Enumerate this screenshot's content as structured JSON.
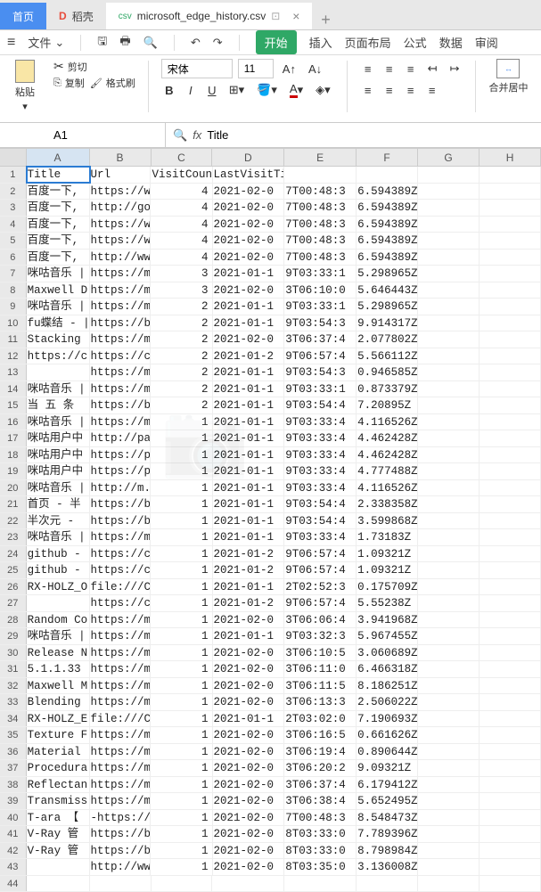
{
  "tabs": {
    "home": "首页",
    "shell": "稻壳",
    "file": "microsoft_edge_history.csv"
  },
  "menus": {
    "file": "文件",
    "start": "开始",
    "insert": "插入",
    "layout": "页面布局",
    "formula": "公式",
    "data": "数据",
    "review": "审阅"
  },
  "ribbon": {
    "paste": "粘贴",
    "cut": "剪切",
    "copy": "复制",
    "format_painter": "格式刷",
    "fontname": "宋体",
    "fontsize": "11",
    "merge": "合并居中"
  },
  "namebox": "A1",
  "formula_value": "Title",
  "columns": [
    "A",
    "B",
    "C",
    "D",
    "E",
    "F",
    "G",
    "H"
  ],
  "rows": [
    {
      "n": 1,
      "A": "Title",
      "B": "Url",
      "C": "VisitCount",
      "D": "LastVisitTime",
      "E": "",
      "F": ""
    },
    {
      "n": 2,
      "A": "百度一下,",
      "B": "https://w",
      "C": "4",
      "D": "2021-02-0",
      "E": "7T00:48:3",
      "F": "6.594389Z"
    },
    {
      "n": 3,
      "A": "百度一下,",
      "B": "http://go",
      "C": "4",
      "D": "2021-02-0",
      "E": "7T00:48:3",
      "F": "6.594389Z"
    },
    {
      "n": 4,
      "A": "百度一下,",
      "B": "https://w",
      "C": "4",
      "D": "2021-02-0",
      "E": "7T00:48:3",
      "F": "6.594389Z"
    },
    {
      "n": 5,
      "A": "百度一下,",
      "B": "https://w",
      "C": "4",
      "D": "2021-02-0",
      "E": "7T00:48:3",
      "F": "6.594389Z"
    },
    {
      "n": 6,
      "A": "百度一下,",
      "B": "http://ww",
      "C": "4",
      "D": "2021-02-0",
      "E": "7T00:48:3",
      "F": "6.594389Z"
    },
    {
      "n": 7,
      "A": "咪咕音乐 |",
      "B": "https://m",
      "C": "3",
      "D": "2021-01-1",
      "E": "9T03:33:1",
      "F": "5.298965Z"
    },
    {
      "n": 8,
      "A": "Maxwell D",
      "B": "https://m",
      "C": "3",
      "D": "2021-02-0",
      "E": "3T06:10:0",
      "F": "5.646443Z"
    },
    {
      "n": 9,
      "A": "咪咕音乐 |",
      "B": "https://m",
      "C": "2",
      "D": "2021-01-1",
      "E": "9T03:33:1",
      "F": "5.298965Z"
    },
    {
      "n": 10,
      "A": "fu蝶结 - |",
      "B": "https://b",
      "C": "2",
      "D": "2021-01-1",
      "E": "9T03:54:3",
      "F": "9.914317Z"
    },
    {
      "n": 11,
      "A": "Stacking ",
      "B": "https://m",
      "C": "2",
      "D": "2021-02-0",
      "E": "3T06:37:4",
      "F": "2.077802Z"
    },
    {
      "n": 12,
      "A": "https://c",
      "B": "https://c",
      "C": "2",
      "D": "2021-01-2",
      "E": "9T06:57:4",
      "F": "5.566112Z"
    },
    {
      "n": 13,
      "A": "",
      "B": "https://m",
      "C": "2",
      "D": "2021-01-1",
      "E": "9T03:54:3",
      "F": "0.946585Z"
    },
    {
      "n": 14,
      "A": "咪咕音乐 |",
      "B": "https://m",
      "C": "2",
      "D": "2021-01-1",
      "E": "9T03:33:1",
      "F": "0.873379Z"
    },
    {
      "n": 15,
      "A": "当 五 条",
      "B": "https://b",
      "C": "2",
      "D": "2021-01-1",
      "E": "9T03:54:4",
      "F": "7.20895Z"
    },
    {
      "n": 16,
      "A": "咪咕音乐 |",
      "B": "https://m",
      "C": "1",
      "D": "2021-01-1",
      "E": "9T03:33:4",
      "F": "4.116526Z"
    },
    {
      "n": 17,
      "A": "咪咕用户中",
      "B": "http://pa",
      "C": "1",
      "D": "2021-01-1",
      "E": "9T03:33:4",
      "F": "4.462428Z"
    },
    {
      "n": 18,
      "A": "咪咕用户中",
      "B": "https://p",
      "C": "1",
      "D": "2021-01-1",
      "E": "9T03:33:4",
      "F": "4.462428Z"
    },
    {
      "n": 19,
      "A": "咪咕用户中",
      "B": "https://p",
      "C": "1",
      "D": "2021-01-1",
      "E": "9T03:33:4",
      "F": "4.777488Z"
    },
    {
      "n": 20,
      "A": "咪咕音乐 |",
      "B": "http://m.",
      "C": "1",
      "D": "2021-01-1",
      "E": "9T03:33:4",
      "F": "4.116526Z"
    },
    {
      "n": 21,
      "A": "首页 - 半",
      "B": "https://b",
      "C": "1",
      "D": "2021-01-1",
      "E": "9T03:54:4",
      "F": "2.338358Z"
    },
    {
      "n": 22,
      "A": "半次元 - ",
      "B": "https://b",
      "C": "1",
      "D": "2021-01-1",
      "E": "9T03:54:4",
      "F": "3.599868Z"
    },
    {
      "n": 23,
      "A": "咪咕音乐 |",
      "B": "https://m",
      "C": "1",
      "D": "2021-01-1",
      "E": "9T03:33:4",
      "F": "1.73183Z"
    },
    {
      "n": 24,
      "A": "github - ",
      "B": "https://c",
      "C": "1",
      "D": "2021-01-2",
      "E": "9T06:57:4",
      "F": "1.09321Z"
    },
    {
      "n": 25,
      "A": "github - ",
      "B": "https://c",
      "C": "1",
      "D": "2021-01-2",
      "E": "9T06:57:4",
      "F": "1.09321Z"
    },
    {
      "n": 26,
      "A": "RX-HOLZ_O",
      "B": "file:///C",
      "C": "1",
      "D": "2021-01-1",
      "E": "2T02:52:3",
      "F": "0.175709Z"
    },
    {
      "n": 27,
      "A": "",
      "B": "https://c",
      "C": "1",
      "D": "2021-01-2",
      "E": "9T06:57:4",
      "F": "5.55238Z"
    },
    {
      "n": 28,
      "A": "Random Co",
      "B": "https://m",
      "C": "1",
      "D": "2021-02-0",
      "E": "3T06:06:4",
      "F": "3.941968Z"
    },
    {
      "n": 29,
      "A": "咪咕音乐 |",
      "B": "https://m",
      "C": "1",
      "D": "2021-01-1",
      "E": "9T03:32:3",
      "F": "5.967455Z"
    },
    {
      "n": 30,
      "A": "Release N",
      "B": "https://m",
      "C": "1",
      "D": "2021-02-0",
      "E": "3T06:10:5",
      "F": "3.060689Z"
    },
    {
      "n": 31,
      "A": "5.1.1.33 ",
      "B": "https://m",
      "C": "1",
      "D": "2021-02-0",
      "E": "3T06:11:0",
      "F": "6.466318Z"
    },
    {
      "n": 32,
      "A": "Maxwell M",
      "B": "https://m",
      "C": "1",
      "D": "2021-02-0",
      "E": "3T06:11:5",
      "F": "8.186251Z"
    },
    {
      "n": 33,
      "A": "Blending ",
      "B": "https://m",
      "C": "1",
      "D": "2021-02-0",
      "E": "3T06:13:3",
      "F": "2.506022Z"
    },
    {
      "n": 34,
      "A": "RX-HOLZ_E",
      "B": "file:///C",
      "C": "1",
      "D": "2021-01-1",
      "E": "2T03:02:0",
      "F": "7.190693Z"
    },
    {
      "n": 35,
      "A": "Texture F",
      "B": "https://m",
      "C": "1",
      "D": "2021-02-0",
      "E": "3T06:16:5",
      "F": "0.661626Z"
    },
    {
      "n": 36,
      "A": "Material ",
      "B": "https://m",
      "C": "1",
      "D": "2021-02-0",
      "E": "3T06:19:4",
      "F": "0.890644Z"
    },
    {
      "n": 37,
      "A": "Procedura",
      "B": "https://m",
      "C": "1",
      "D": "2021-02-0",
      "E": "3T06:20:2",
      "F": "9.09321Z"
    },
    {
      "n": 38,
      "A": "Reflectan",
      "B": "https://m",
      "C": "1",
      "D": "2021-02-0",
      "E": "3T06:37:4",
      "F": "6.179412Z"
    },
    {
      "n": 39,
      "A": "Transmiss",
      "B": "https://m",
      "C": "1",
      "D": "2021-02-0",
      "E": "3T06:38:4",
      "F": "5.652495Z"
    },
    {
      "n": 40,
      "A": "T-ara 【",
      "B": "-https://w",
      "C": "1",
      "D": "2021-02-0",
      "E": "7T00:48:3",
      "F": "8.548473Z"
    },
    {
      "n": 41,
      "A": "V-Ray 管",
      "B": "https://b",
      "C": "1",
      "D": "2021-02-0",
      "E": "8T03:33:0",
      "F": "7.789396Z"
    },
    {
      "n": 42,
      "A": "V-Ray 管",
      "B": "https://b",
      "C": "1",
      "D": "2021-02-0",
      "E": "8T03:33:0",
      "F": "8.798984Z"
    },
    {
      "n": 43,
      "A": "",
      "B": "http://ww",
      "C": "1",
      "D": "2021-02-0",
      "E": "8T03:35:0",
      "F": "3.136008Z"
    },
    {
      "n": 44,
      "A": "",
      "B": "",
      "C": "",
      "D": "",
      "E": "",
      "F": ""
    }
  ]
}
